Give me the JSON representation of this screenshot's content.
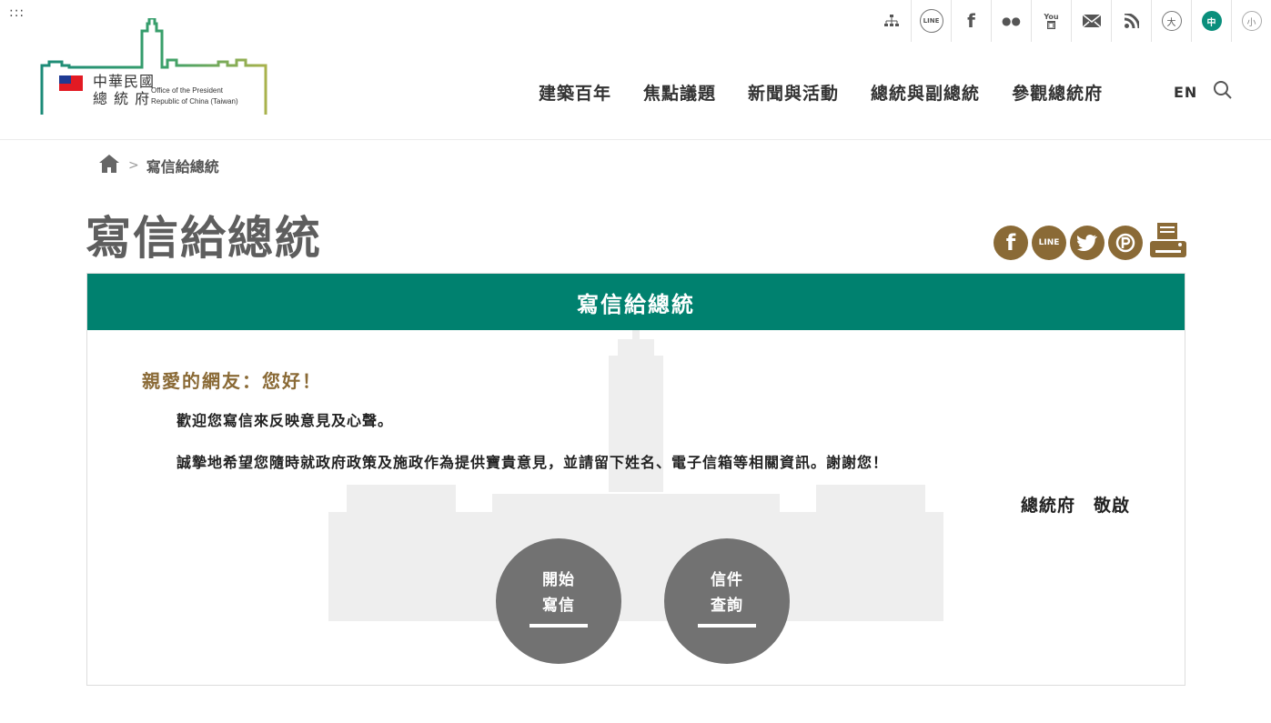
{
  "apps_label": ":::",
  "topbar": {
    "sitemap_icon": "sitemap-icon",
    "line_label": "LINE",
    "facebook_label": "f",
    "flickr_label": "●●",
    "youtube_label": "You",
    "font_large": "大",
    "lang_zh": "中",
    "font_small": "小"
  },
  "logo": {
    "line1": "中華民國",
    "line2": "總 統 府",
    "en1": "Office of the President",
    "en2": "Republic of China (Taiwan)"
  },
  "nav": [
    "建築百年",
    "焦點議題",
    "新聞與活動",
    "總統與副總統",
    "參觀總統府"
  ],
  "en_link": "EN",
  "breadcrumb": {
    "sep": ">",
    "current": "寫信給總統"
  },
  "page_title": "寫信給總統",
  "share": {
    "line": "LINE"
  },
  "panel": {
    "title": "寫信給總統",
    "greeting": "親愛的網友：您好！",
    "para1": "歡迎您寫信來反映意見及心聲。",
    "para2": "誠摯地希望您隨時就政府政策及施政作為提供寶貴意見，並請留下姓名、電子信箱等相關資訊。謝謝您！",
    "signature": "總統府　敬啟"
  },
  "buttons": {
    "start": {
      "line1": "開始",
      "line2": "寫信"
    },
    "query": {
      "line1": "信件",
      "line2": "查詢"
    }
  },
  "colors": {
    "accent": "#00816f",
    "brown": "#8a6a36",
    "button": "#727272"
  }
}
